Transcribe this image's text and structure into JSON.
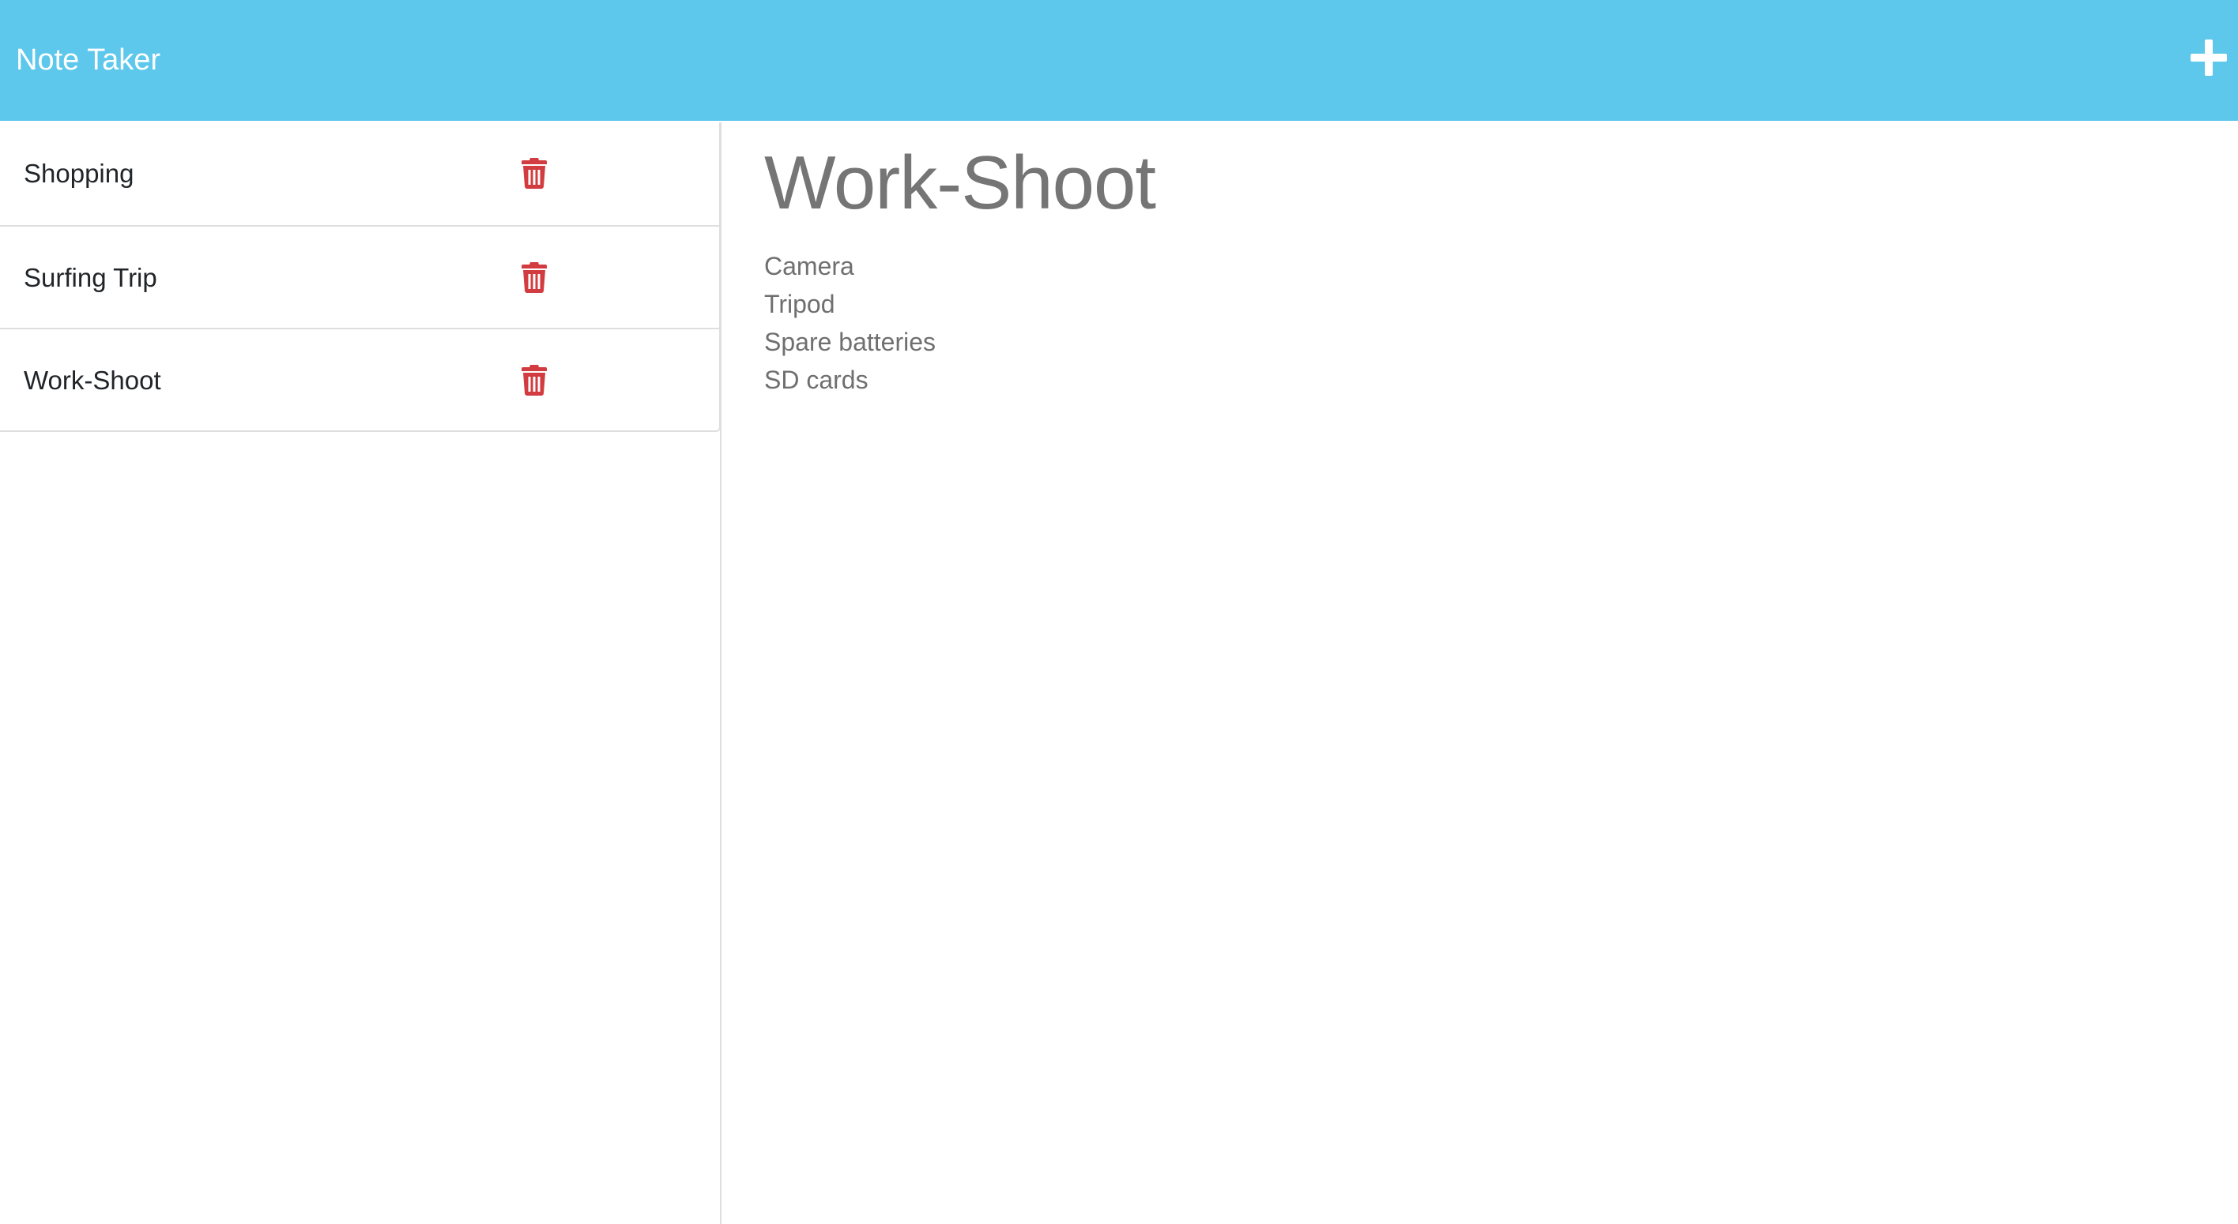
{
  "app": {
    "title": "Note Taker",
    "accent_color": "#5dc8ec",
    "delete_color": "#d23b3f"
  },
  "toolbar": {
    "new_note_icon": "plus-icon"
  },
  "notes": [
    {
      "title": "Shopping",
      "delete_icon": "trash-icon"
    },
    {
      "title": "Surfing Trip",
      "delete_icon": "trash-icon"
    },
    {
      "title": "Work-Shoot",
      "delete_icon": "trash-icon"
    }
  ],
  "active_note": {
    "title": "Work-Shoot",
    "lines": [
      "Camera",
      "Tripod",
      "Spare batteries",
      "SD cards"
    ]
  }
}
